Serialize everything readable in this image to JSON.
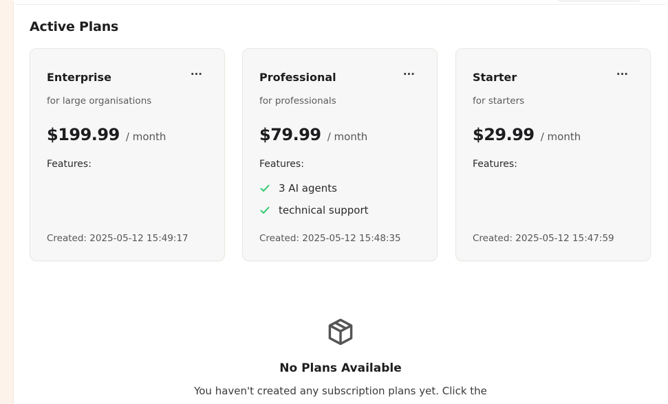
{
  "section": {
    "title": "Active Plans"
  },
  "plans": [
    {
      "name": "Enterprise",
      "description": "for large organisations",
      "price": "$199.99",
      "period": "/ month",
      "features_label": "Features:",
      "features": [],
      "created": "Created: 2025-05-12 15:49:17"
    },
    {
      "name": "Professional",
      "description": "for professionals",
      "price": "$79.99",
      "period": "/ month",
      "features_label": "Features:",
      "features": [
        "3 AI agents",
        "technical support"
      ],
      "created": "Created: 2025-05-12 15:48:35"
    },
    {
      "name": "Starter",
      "description": "for starters",
      "price": "$29.99",
      "period": "/ month",
      "features_label": "Features:",
      "features": [],
      "created": "Created: 2025-05-12 15:47:59"
    }
  ],
  "menu_label": "···",
  "empty_state": {
    "icon": "package-icon",
    "title": "No Plans Available",
    "text": "You haven't created any subscription plans yet. Click the"
  },
  "colors": {
    "check": "#22c55e",
    "card_bg": "#f7f7f7",
    "left_strip": "#fdf3ea"
  }
}
